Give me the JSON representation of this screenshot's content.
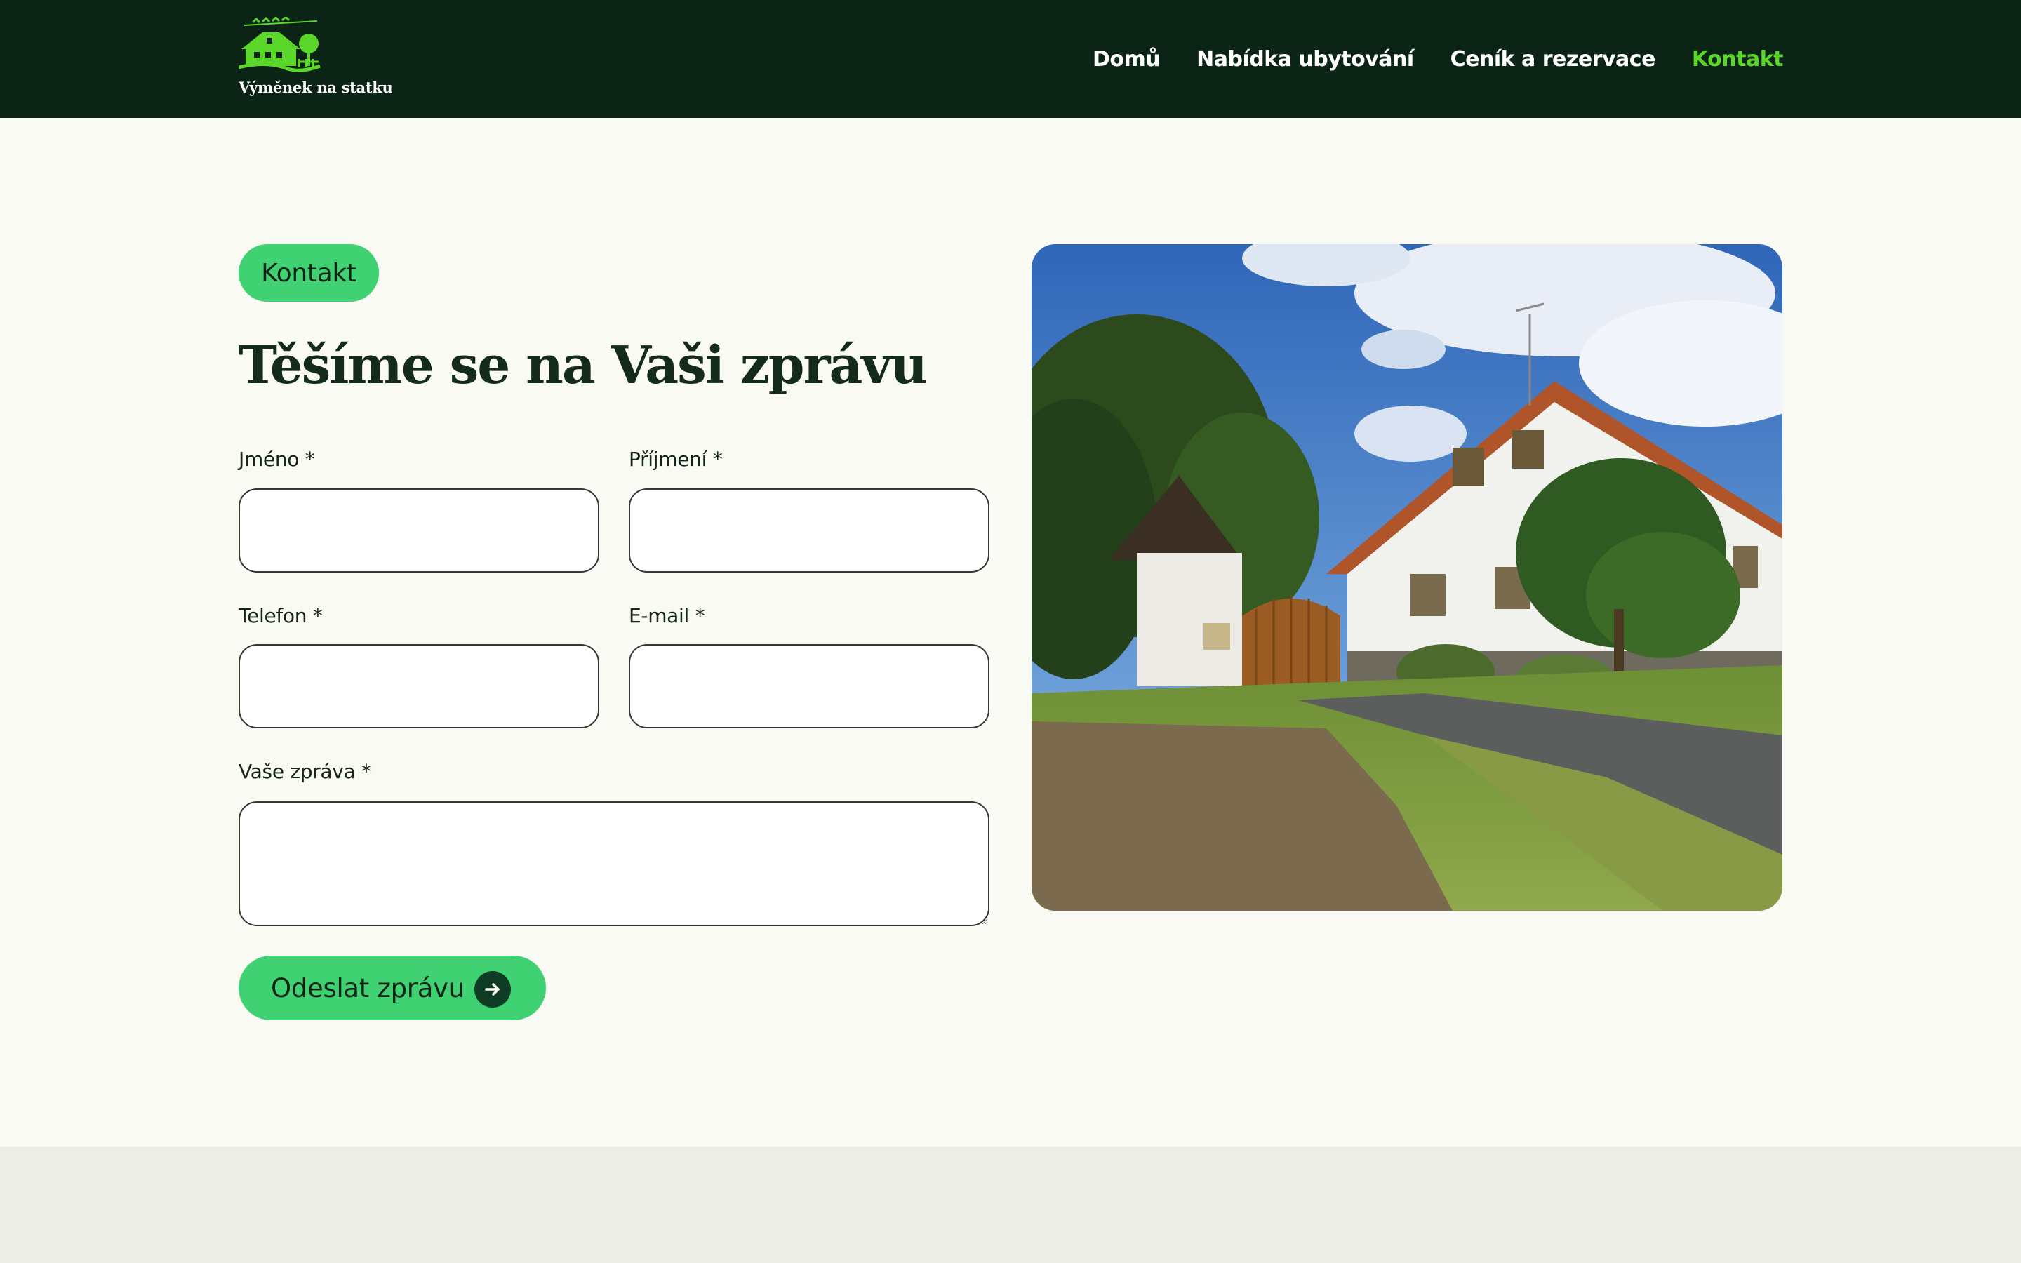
{
  "header": {
    "logo_text": "Výměnek na statku",
    "nav": [
      {
        "label": "Domů"
      },
      {
        "label": "Nabídka ubytování"
      },
      {
        "label": "Ceník a rezervace"
      },
      {
        "label": "Kontakt"
      }
    ],
    "active_nav": "Kontakt"
  },
  "main": {
    "badge": "Kontakt",
    "title": "Těšíme se na Vaši zprávu",
    "form": {
      "first_name": {
        "label": "Jméno *",
        "value": ""
      },
      "last_name": {
        "label": "Příjmení *",
        "value": ""
      },
      "phone": {
        "label": "Telefon *",
        "value": ""
      },
      "email": {
        "label": "E-mail *",
        "value": ""
      },
      "message": {
        "label": "Vaše zpráva *",
        "value": ""
      },
      "submit_label": "Odeslat zprávu"
    },
    "photo": {
      "icon": "farmhouse-photo"
    }
  },
  "colors": {
    "header_bg": "#0b2415",
    "page_bg": "#f9faf4",
    "accent_green": "#3fd172",
    "nav_active": "#5bd62b",
    "footer_bg": "#edede7"
  },
  "icons": [
    "farmhouse-logo-icon",
    "arrow-right-icon"
  ]
}
